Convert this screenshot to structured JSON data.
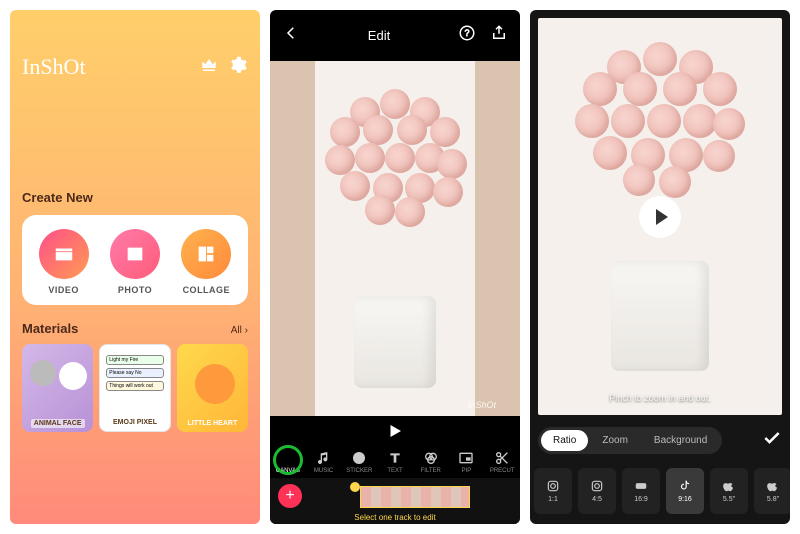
{
  "screen1": {
    "logo": "InShOt",
    "sections": {
      "create": "Create New",
      "materials": "Materials",
      "all": "All  ›"
    },
    "create": [
      {
        "label": "VIDEO"
      },
      {
        "label": "PHOTO"
      },
      {
        "label": "COLLAGE"
      }
    ],
    "materials": [
      {
        "label": "ANIMAL FACE"
      },
      {
        "label": "EMOJI PIXEL",
        "bubbles": [
          "Light my Fire",
          "Please say No",
          "Things will work out"
        ]
      },
      {
        "label": "LITTLE HEART"
      }
    ]
  },
  "screen2": {
    "title": "Edit",
    "watermark": "InShOt",
    "tools": [
      {
        "name": "CANVAS"
      },
      {
        "name": "MUSIC"
      },
      {
        "name": "STICKER"
      },
      {
        "name": "TEXT"
      },
      {
        "name": "FILTER"
      },
      {
        "name": "PIP"
      },
      {
        "name": "PRECUT"
      }
    ],
    "hint": "Select one track to edit"
  },
  "screen3": {
    "pinch_hint": "Pinch to zoom in and out.",
    "tabs": [
      "Ratio",
      "Zoom",
      "Background"
    ],
    "ratios": [
      {
        "label": "1:1",
        "icon": "instagram"
      },
      {
        "label": "4:5",
        "icon": "instagram"
      },
      {
        "label": "16:9",
        "icon": "youtube"
      },
      {
        "label": "9:16",
        "icon": "tiktok"
      },
      {
        "label": "5.5\"",
        "icon": "apple"
      },
      {
        "label": "5.8\"",
        "icon": "apple"
      }
    ],
    "active_ratio": 3
  }
}
